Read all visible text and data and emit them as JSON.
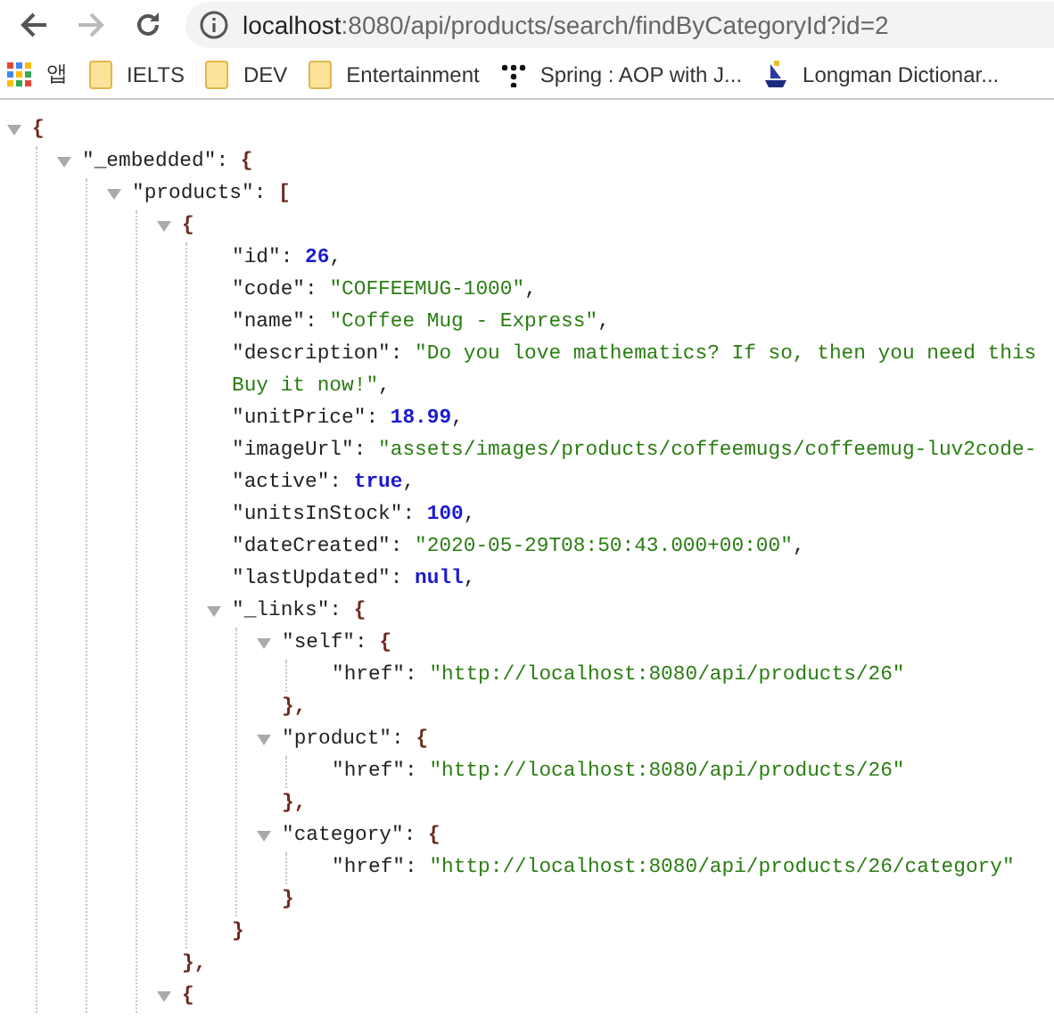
{
  "browser": {
    "back_disabled": false,
    "forward_disabled": true,
    "url_host": "localhost",
    "url_rest": ":8080/api/products/search/findByCategoryId?id=2"
  },
  "bookmarks": [
    {
      "kind": "apps",
      "label": "앱"
    },
    {
      "kind": "folder",
      "label": "IELTS"
    },
    {
      "kind": "folder",
      "label": "DEV"
    },
    {
      "kind": "folder",
      "label": "Entertainment"
    },
    {
      "kind": "dots",
      "label": "Spring : AOP with J..."
    },
    {
      "kind": "ship",
      "label": "Longman Dictionar..."
    }
  ],
  "document": {
    "kind": "container",
    "open": "{",
    "expanded": true,
    "children": [
      {
        "kind": "container",
        "key": "\"_embedded\":",
        "open": "{",
        "expanded": true,
        "children": [
          {
            "kind": "container",
            "key": "\"products\":",
            "open": "[",
            "expanded": true,
            "children": [
              {
                "kind": "container",
                "open": "{",
                "close": "},",
                "expanded": true,
                "children": [
                  {
                    "kind": "number",
                    "key": "\"id\":",
                    "value": "26",
                    "suffix": ","
                  },
                  {
                    "kind": "string",
                    "key": "\"code\":",
                    "value": "\"COFFEEMUG-1000\"",
                    "suffix": ","
                  },
                  {
                    "kind": "string",
                    "key": "\"name\":",
                    "value": "\"Coffee Mug - Express\"",
                    "suffix": ","
                  },
                  {
                    "kind": "string",
                    "key": "\"description\":",
                    "value": "\"Do you love mathematics? If so, then you need this",
                    "continuation": "Buy it now!\"",
                    "suffix": ","
                  },
                  {
                    "kind": "number",
                    "key": "\"unitPrice\":",
                    "value": "18.99",
                    "suffix": ","
                  },
                  {
                    "kind": "string",
                    "key": "\"imageUrl\":",
                    "value": "\"assets/images/products/coffeemugs/coffeemug-luv2code-"
                  },
                  {
                    "kind": "keyword",
                    "key": "\"active\":",
                    "value": "true",
                    "suffix": ","
                  },
                  {
                    "kind": "number",
                    "key": "\"unitsInStock\":",
                    "value": "100",
                    "suffix": ","
                  },
                  {
                    "kind": "string",
                    "key": "\"dateCreated\":",
                    "value": "\"2020-05-29T08:50:43.000+00:00\"",
                    "suffix": ","
                  },
                  {
                    "kind": "keyword",
                    "key": "\"lastUpdated\":",
                    "value": "null",
                    "suffix": ","
                  },
                  {
                    "kind": "container",
                    "key": "\"_links\":",
                    "open": "{",
                    "close": "}",
                    "expanded": true,
                    "children": [
                      {
                        "kind": "container",
                        "key": "\"self\":",
                        "open": "{",
                        "close": "},",
                        "expanded": true,
                        "children": [
                          {
                            "kind": "string",
                            "key": "\"href\":",
                            "value": "\"http://localhost:8080/api/products/26\""
                          }
                        ]
                      },
                      {
                        "kind": "container",
                        "key": "\"product\":",
                        "open": "{",
                        "close": "},",
                        "expanded": true,
                        "children": [
                          {
                            "kind": "string",
                            "key": "\"href\":",
                            "value": "\"http://localhost:8080/api/products/26\""
                          }
                        ]
                      },
                      {
                        "kind": "container",
                        "key": "\"category\":",
                        "open": "{",
                        "close": "}",
                        "expanded": true,
                        "children": [
                          {
                            "kind": "string",
                            "key": "\"href\":",
                            "value": "\"http://localhost:8080/api/products/26/category\""
                          }
                        ]
                      }
                    ]
                  }
                ]
              },
              {
                "kind": "container",
                "open": "{",
                "expanded": true
              }
            ]
          }
        ]
      }
    ]
  }
}
